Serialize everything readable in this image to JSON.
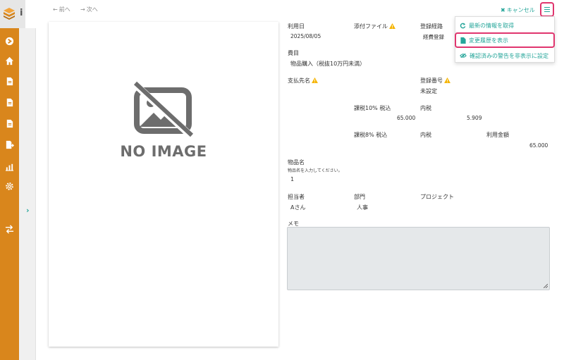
{
  "app": {
    "logo_letter": "i"
  },
  "sidebar": {
    "icons": [
      "circle-arrow-icon",
      "home-icon",
      "document-icon",
      "document-icon",
      "document-icon",
      "export-icon",
      "chart-icon",
      "gear-icon",
      "transfer-icon"
    ]
  },
  "nav": {
    "prev_label": "前へ",
    "next_label": "次へ"
  },
  "preview": {
    "no_image_text": "NO IMAGE"
  },
  "actions": {
    "cancel_label": "キャンセル"
  },
  "menu": {
    "items": [
      {
        "label": "最新の情報を取得",
        "icon": "refresh-icon"
      },
      {
        "label": "変更履歴を表示",
        "icon": "file-icon"
      },
      {
        "label": "確認済みの警告を非表示に設定",
        "icon": "eye-slash-icon"
      }
    ]
  },
  "form": {
    "usage_date_label": "利用日",
    "usage_date_value": "2025/08/05",
    "attachment_label": "添付ファイル",
    "route_label": "登録経路",
    "route_value": "経費登録",
    "expense_item_label": "費目",
    "expense_item_value": "物品購入（税抜10万円未満）",
    "payee_label": "支払先名",
    "reg_number_label": "登録番号",
    "reg_number_value": "未設定",
    "tax10_label": "課税10% 税込",
    "tax10_value": "65.000",
    "internal_tax_label_1": "内税",
    "internal_tax_value_1": "5.909",
    "tax8_label": "課税8% 税込",
    "internal_tax_label_2": "内税",
    "amount_label": "利用金額",
    "amount_value": "65.000",
    "item_name_label": "物品名",
    "item_name_hint": "物品名を入力してください。",
    "item_name_value": "1",
    "person_label": "担当者",
    "person_value": "Aさん",
    "dept_label": "部門",
    "dept_value": "人事",
    "project_label": "プロジェクト",
    "memo_label": "メモ",
    "memo_value": ""
  },
  "colors": {
    "sidebar": "#d9861c",
    "accent": "#26a69a",
    "highlight": "#e0356e",
    "warning": "#f5b400"
  }
}
